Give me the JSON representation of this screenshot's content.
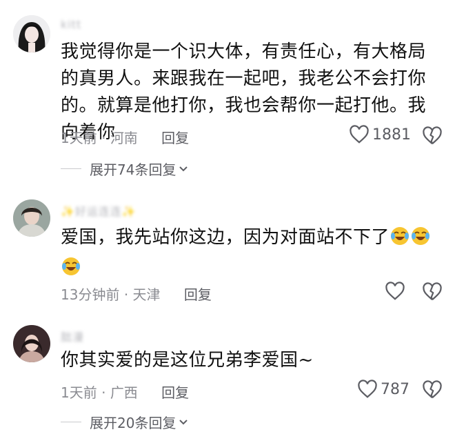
{
  "comments": [
    {
      "username": "kitt",
      "text": "我觉得你是一个识大体，有责任心，有大格局的真男人。来跟我在一起吧，我老公不会打你的。就算是他打你，我也会帮你一起打他。我向着你",
      "time": "1天前",
      "location": "河南",
      "reply_label": "回复",
      "likes": "1881",
      "expand_label": "展开74条回复"
    },
    {
      "username": "✨好运连连✨",
      "text": "爱国，我先站你这边，因为对面站不下了",
      "emoji": "crying-laughing-emoji",
      "time": "13分钟前",
      "location": "天津",
      "reply_label": "回复",
      "likes": ""
    },
    {
      "username": "朏漫",
      "text": "你其实爱的是这位兄弟李爱国~",
      "time": "1天前",
      "location": "广西",
      "reply_label": "回复",
      "likes": "787",
      "expand_label": "展开20条回复"
    }
  ],
  "icons": {
    "like": "heart-outline-icon",
    "dislike": "broken-heart-icon",
    "expand": "chevron-down-icon"
  }
}
